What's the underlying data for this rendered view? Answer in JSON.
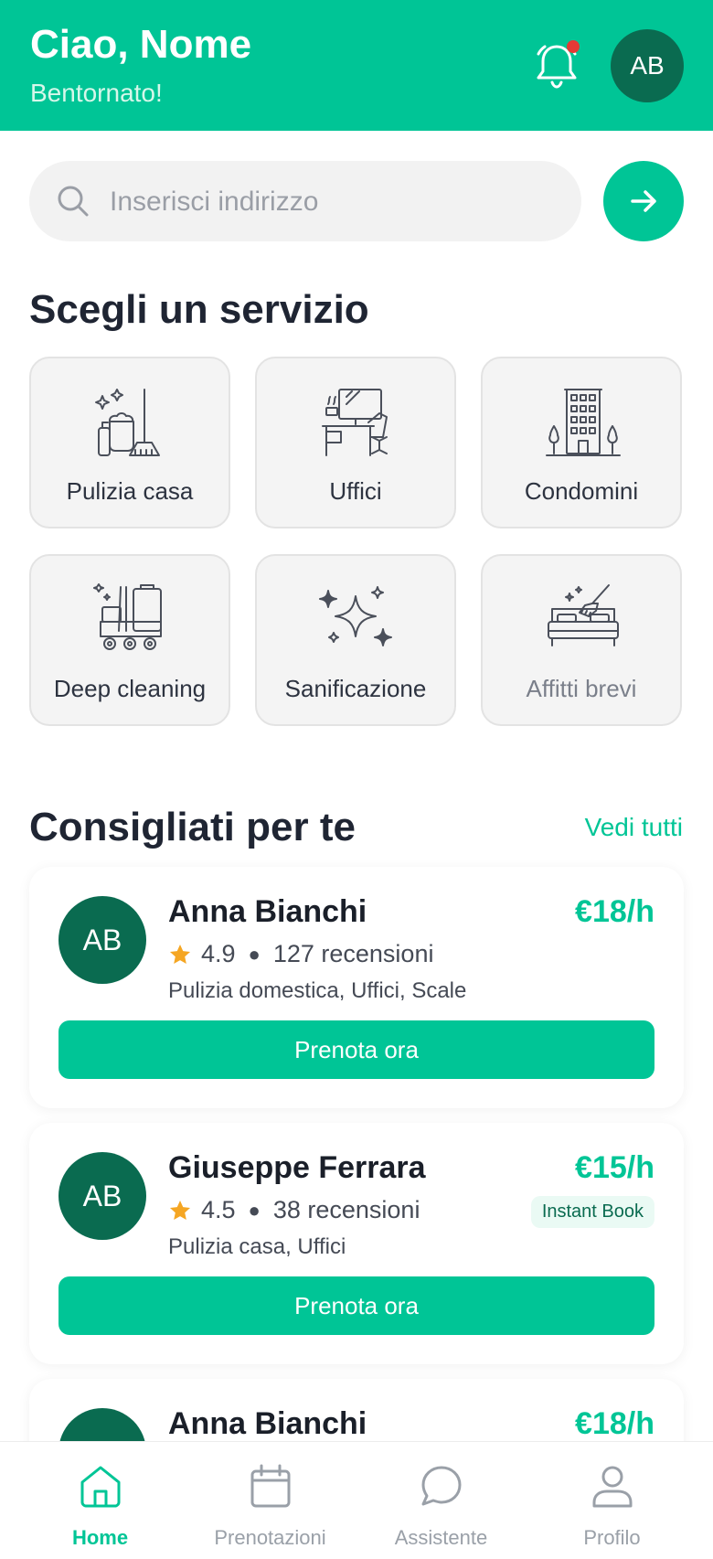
{
  "header": {
    "greeting": "Ciao, Nome",
    "subtitle": "Bentornato!",
    "avatar_initials": "AB",
    "has_notification": true
  },
  "search": {
    "placeholder": "Inserisci indirizzo",
    "value": ""
  },
  "services": {
    "title": "Scegli un servizio",
    "items": [
      {
        "label": "Pulizia casa",
        "icon": "cleaning-supplies-icon"
      },
      {
        "label": "Uffici",
        "icon": "office-desk-icon"
      },
      {
        "label": "Condomini",
        "icon": "building-icon"
      },
      {
        "label": "Deep cleaning",
        "icon": "cleaning-cart-icon"
      },
      {
        "label": "Sanificazione",
        "icon": "sparkles-icon"
      },
      {
        "label": "Affitti brevi",
        "icon": "bed-broom-icon"
      }
    ]
  },
  "recommended": {
    "title": "Consigliati per te",
    "see_all": "Vedi tutti",
    "cards": [
      {
        "initials": "AB",
        "name": "Anna Bianchi",
        "price": "€18/h",
        "rating": "4.9",
        "reviews": "127 recensioni",
        "services": "Pulizia domestica, Uffici, Scale",
        "cta": "Prenota ora"
      },
      {
        "initials": "AB",
        "name": "Giuseppe Ferrara",
        "price": "€15/h",
        "rating": "4.5",
        "reviews": "38 recensioni",
        "services": "Pulizia casa, Uffici",
        "badge": "Instant Book",
        "cta": "Prenota ora"
      },
      {
        "initials": "AB",
        "name": "Anna Bianchi",
        "price": "€18/h"
      }
    ]
  },
  "bottom_nav": {
    "items": [
      {
        "label": "Home",
        "icon": "home-icon",
        "active": true
      },
      {
        "label": "Prenotazioni",
        "icon": "calendar-icon",
        "active": false
      },
      {
        "label": "Assistente",
        "icon": "chat-icon",
        "active": false
      },
      {
        "label": "Profilo",
        "icon": "user-icon",
        "active": false
      }
    ]
  },
  "colors": {
    "brand": "#00c596",
    "dark_green": "#0a6b50",
    "star": "#f5a623",
    "notification": "#e53935"
  }
}
